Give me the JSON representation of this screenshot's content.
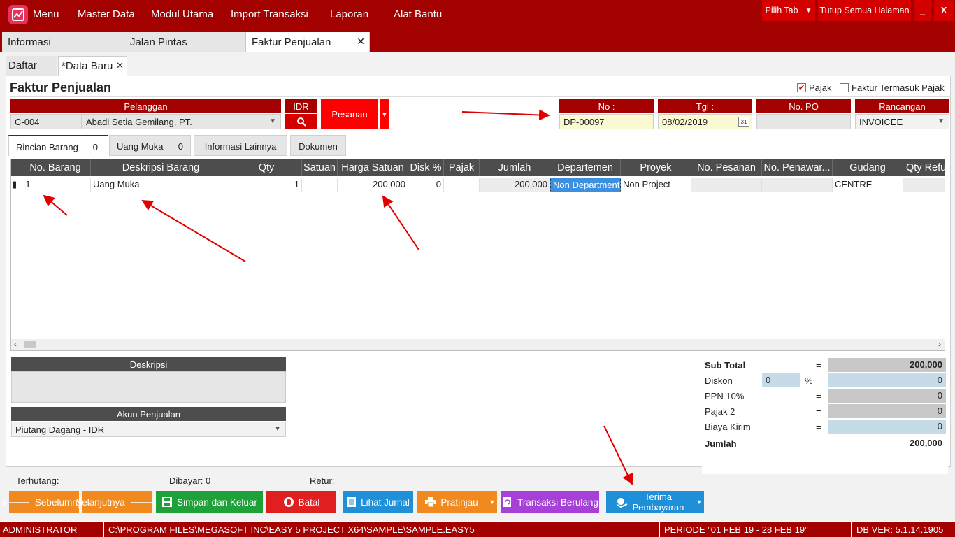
{
  "topbar": {
    "menu": [
      "Menu",
      "Master Data",
      "Modul Utama",
      "Import Transaksi",
      "Laporan",
      "Alat Bantu"
    ],
    "pilih_tab": "Pilih Tab",
    "tutup_semua": "Tutup Semua Halaman",
    "minimize": "_",
    "close": "X"
  },
  "main_tabs": [
    "Informasi",
    "Jalan Pintas",
    "Faktur Penjualan"
  ],
  "sub_tabs": [
    "Daftar",
    "*Data Baru"
  ],
  "form": {
    "title": "Faktur Penjualan",
    "pajak_label": "Pajak",
    "pajak_checked": true,
    "faktur_termasuk_pajak_label": "Faktur Termasuk Pajak",
    "faktur_termasuk_pajak_checked": false,
    "pelanggan_label": "Pelanggan",
    "pelanggan_code": "C-004",
    "pelanggan_name": "Abadi Setia Gemilang, PT.",
    "currency_label": "IDR",
    "pesanan_label": "Pesanan",
    "no_label": "No :",
    "no_value": "DP-00097",
    "tgl_label": "Tgl :",
    "tgl_value": "08/02/2019",
    "calendar_text": "31",
    "no_po_label": "No. PO",
    "no_po_value": "",
    "rancangan_label": "Rancangan",
    "rancangan_value": "INVOICEE"
  },
  "inner_tabs": [
    {
      "label": "Rincian Barang",
      "count": "0"
    },
    {
      "label": "Uang Muka",
      "count": "0"
    },
    {
      "label": "Informasi Lainnya",
      "count": ""
    },
    {
      "label": "Dokumen",
      "count": ""
    }
  ],
  "grid": {
    "columns": [
      "No. Barang",
      "Deskripsi Barang",
      "Qty",
      "Satuan",
      "Harga Satuan",
      "Disk %",
      "Pajak",
      "Jumlah",
      "Departemen",
      "Proyek",
      "No. Pesanan",
      "No. Penawar...",
      "Gudang",
      "Qty Refu"
    ],
    "rows": [
      {
        "no_barang": "-1",
        "deskripsi": "Uang Muka",
        "qty": "1",
        "satuan": "",
        "harga": "200,000",
        "disk": "0",
        "pajak": "",
        "jumlah": "200,000",
        "departemen": "Non Department",
        "proyek": "Non Project",
        "no_pesanan": "",
        "no_penawaran": "",
        "gudang": "CENTRE",
        "qty_refund": ""
      }
    ]
  },
  "deskripsi_label": "Deskripsi",
  "akun_label": "Akun Penjualan",
  "akun_value": "Piutang Dagang - IDR",
  "totals": {
    "sub_total_label": "Sub Total",
    "sub_total": "200,000",
    "diskon_label": "Diskon",
    "diskon_pct": "0",
    "pct_sign": "%",
    "diskon": "0",
    "ppn_label": "PPN 10%",
    "ppn": "0",
    "pajak2_label": "Pajak 2",
    "pajak2": "0",
    "biaya_kirim_label": "Biaya Kirim",
    "biaya_kirim": "0",
    "jumlah_label": "Jumlah",
    "jumlah": "200,000",
    "eq": "="
  },
  "summary": {
    "terhutang": "Terhutang:",
    "dibayar": "Dibayar: 0",
    "retur": "Retur:"
  },
  "buttons": {
    "sebelumnya": "Sebelumnya",
    "selanjutnya": "Selanjutnya",
    "simpan": "Simpan dan Keluar",
    "batal": "Batal",
    "lihat_jurnal": "Lihat Jurnal",
    "pratinjau": "Pratinjau",
    "transaksi_berulang": "Transaksi Berulang",
    "terima_pembayaran_1": "Terima",
    "terima_pembayaran_2": "Pembayaran"
  },
  "statusbar": {
    "user": "ADMINISTRATOR",
    "path": "C:\\PROGRAM FILES\\MEGASOFT INC\\EASY 5 PROJECT X64\\SAMPLE\\SAMPLE.EASY5",
    "periode": "PERIODE \"01 FEB 19 - 28 FEB 19\"",
    "db_ver": "DB VER: 5.1.14.1905"
  },
  "colors": {
    "brand_red": "#a30000",
    "button_red": "#d40000",
    "orange": "#f0891e",
    "green": "#1fa13a",
    "blue": "#1f8fd8",
    "purple": "#a640d6",
    "annotation_red": "#e00000"
  }
}
